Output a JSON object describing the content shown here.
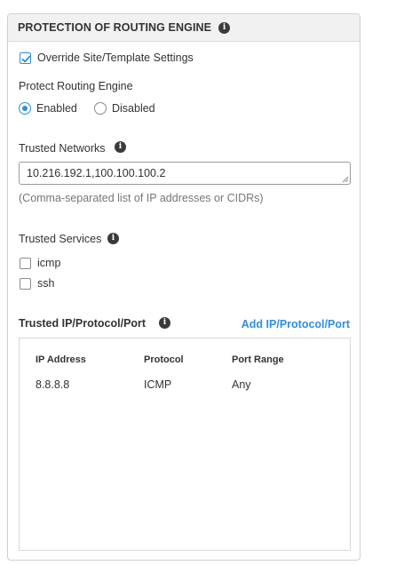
{
  "panel": {
    "title": "PROTECTION OF ROUTING ENGINE",
    "override": {
      "label": "Override Site/Template Settings",
      "checked": true
    },
    "protect": {
      "label": "Protect Routing Engine",
      "options": [
        {
          "label": "Enabled",
          "selected": true
        },
        {
          "label": "Disabled",
          "selected": false
        }
      ]
    },
    "trusted_networks": {
      "label": "Trusted Networks",
      "value": "10.216.192.1,100.100.100.2",
      "hint": "(Comma-separated list of IP addresses or CIDRs)"
    },
    "trusted_services": {
      "label": "Trusted Services",
      "items": [
        {
          "label": "icmp",
          "checked": false
        },
        {
          "label": "ssh",
          "checked": false
        }
      ]
    },
    "trusted_ipp": {
      "label": "Trusted IP/Protocol/Port",
      "add_link": "Add IP/Protocol/Port",
      "columns": [
        "IP Address",
        "Protocol",
        "Port Range"
      ],
      "rows": [
        [
          "8.8.8.8",
          "ICMP",
          "Any"
        ]
      ]
    }
  },
  "icons": {
    "info": "info-icon",
    "check": "checkmark-icon",
    "resize": "resize-grip-icon"
  },
  "colors": {
    "accent": "#2f8ee0",
    "header_bg": "#f1f1f1",
    "border": "#cfcfcf"
  }
}
